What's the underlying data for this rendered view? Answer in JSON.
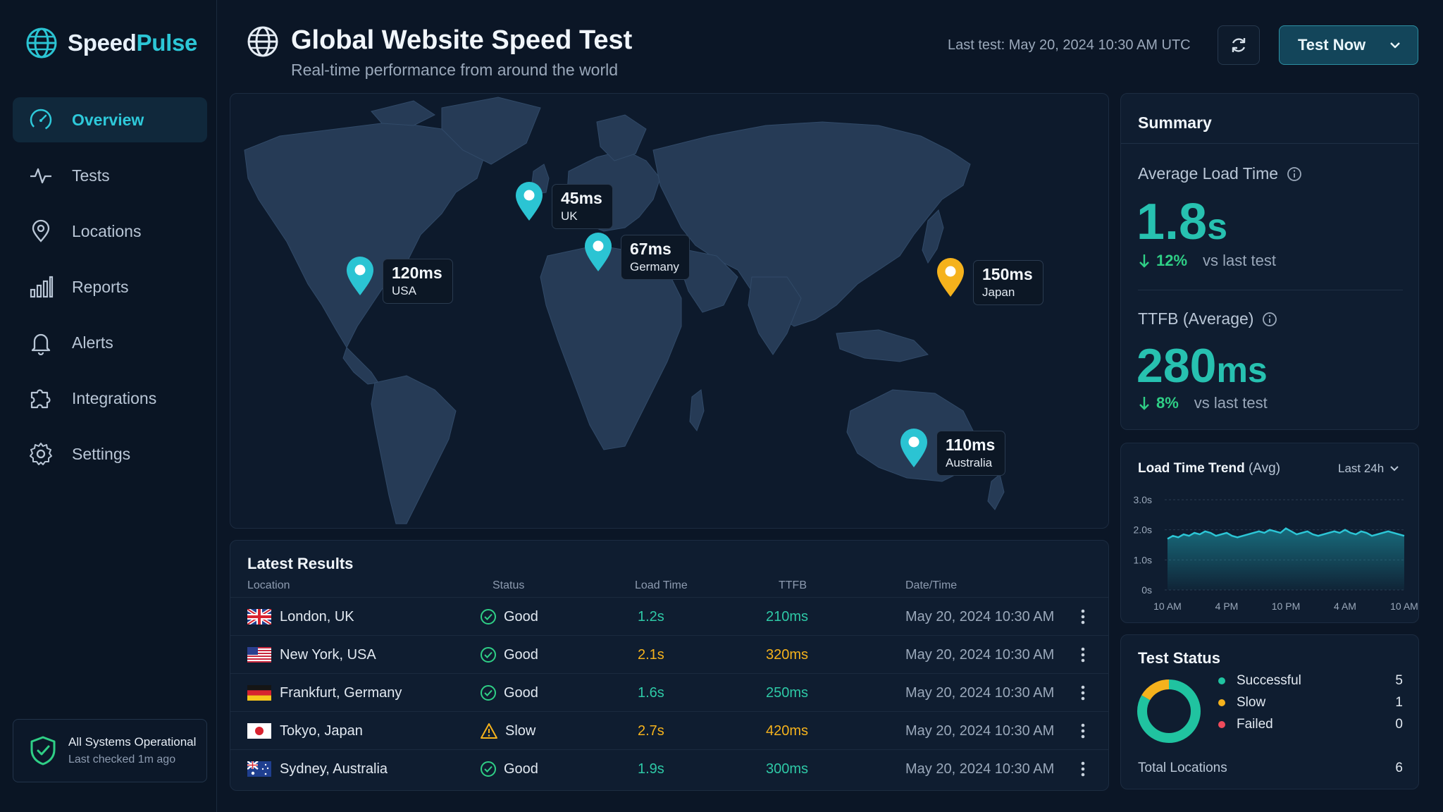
{
  "brand": {
    "prefix": "Speed",
    "suffix": "Pulse"
  },
  "nav": [
    {
      "label": "Overview",
      "icon": "gauge-icon",
      "active": true
    },
    {
      "label": "Tests",
      "icon": "activity-icon"
    },
    {
      "label": "Locations",
      "icon": "map-pin-icon"
    },
    {
      "label": "Reports",
      "icon": "bar-chart-icon"
    },
    {
      "label": "Alerts",
      "icon": "bell-icon"
    },
    {
      "label": "Integrations",
      "icon": "puzzle-icon"
    },
    {
      "label": "Settings",
      "icon": "gear-icon"
    }
  ],
  "system_status": {
    "title": "All Systems Operational",
    "subtitle": "Last checked 1m ago"
  },
  "header": {
    "title": "Global Website Speed Test",
    "subtitle": "Real-time performance from around the world",
    "last_test": "Last test: May 20, 2024 10:30 AM UTC",
    "test_now_label": "Test Now"
  },
  "map_pins": [
    {
      "value": "45ms",
      "city": "UK",
      "color": "#2bc4d3"
    },
    {
      "value": "67ms",
      "city": "Germany",
      "color": "#2bc4d3"
    },
    {
      "value": "120ms",
      "city": "USA",
      "color": "#2bc4d3"
    },
    {
      "value": "150ms",
      "city": "Japan",
      "color": "#f5b21c"
    },
    {
      "value": "110ms",
      "city": "Australia",
      "color": "#2bc4d3"
    }
  ],
  "results": {
    "title": "Latest Results",
    "columns": [
      "Location",
      "Status",
      "Load Time",
      "TTFB",
      "Date/Time"
    ],
    "rows": [
      {
        "location": "London, UK",
        "flag": "uk",
        "status": "Good",
        "load": "1.2s",
        "ttfb": "210ms",
        "datetime": "May 20, 2024 10:30 AM",
        "load_color": "#2ec9a6",
        "ttfb_color": "#2ec9a6"
      },
      {
        "location": "New York, USA",
        "flag": "us",
        "status": "Good",
        "load": "2.1s",
        "ttfb": "320ms",
        "datetime": "May 20, 2024 10:30 AM",
        "load_color": "#f5b21c",
        "ttfb_color": "#f5b21c"
      },
      {
        "location": "Frankfurt, Germany",
        "flag": "de",
        "status": "Good",
        "load": "1.6s",
        "ttfb": "250ms",
        "datetime": "May 20, 2024 10:30 AM",
        "load_color": "#2ec9a6",
        "ttfb_color": "#2ec9a6"
      },
      {
        "location": "Tokyo, Japan",
        "flag": "jp",
        "status": "Slow",
        "load": "2.7s",
        "ttfb": "420ms",
        "datetime": "May 20, 2024 10:30 AM",
        "load_color": "#f5b21c",
        "ttfb_color": "#f5b21c"
      },
      {
        "location": "Sydney, Australia",
        "flag": "au",
        "status": "Good",
        "load": "1.9s",
        "ttfb": "300ms",
        "datetime": "May 20, 2024 10:30 AM",
        "load_color": "#2ec9a6",
        "ttfb_color": "#2ec9a6"
      }
    ]
  },
  "summary": {
    "title": "Summary",
    "avg_load": {
      "label": "Average Load Time",
      "value": "1.8",
      "unit": "s",
      "change": "12%",
      "vs": "vs last test"
    },
    "ttfb": {
      "label": "TTFB (Average)",
      "value": "280",
      "unit": "ms",
      "change": "8%",
      "vs": "vs last test"
    }
  },
  "trend": {
    "title": "Load Time Trend",
    "title_suffix": "(Avg)",
    "range": "Last 24h",
    "y_ticks": [
      "3.0s",
      "2.0s",
      "1.0s",
      "0s"
    ],
    "x_ticks": [
      "10 AM",
      "4 PM",
      "10 PM",
      "4 AM",
      "10 AM"
    ],
    "chart_data": {
      "type": "area",
      "ylim": [
        0,
        3
      ],
      "values": [
        1.7,
        1.8,
        1.75,
        1.85,
        1.8,
        1.9,
        1.85,
        1.95,
        1.9,
        1.8,
        1.85,
        1.9,
        1.8,
        1.75,
        1.8,
        1.85,
        1.9,
        1.95,
        1.9,
        2.0,
        1.95,
        1.9,
        2.05,
        1.95,
        1.85,
        1.9,
        1.95,
        1.85,
        1.8,
        1.85,
        1.9,
        1.95,
        1.9,
        2.0,
        1.9,
        1.85,
        1.95,
        1.9,
        1.8,
        1.85,
        1.9,
        1.95,
        1.9,
        1.85,
        1.8
      ]
    }
  },
  "test_status": {
    "title": "Test Status",
    "items": [
      {
        "label": "Successful",
        "count": "5",
        "color": "#20c3a0"
      },
      {
        "label": "Slow",
        "count": "1",
        "color": "#f5b21c"
      },
      {
        "label": "Failed",
        "count": "0",
        "color": "#ef4b5b"
      }
    ],
    "total_label": "Total Locations",
    "total": "6"
  }
}
